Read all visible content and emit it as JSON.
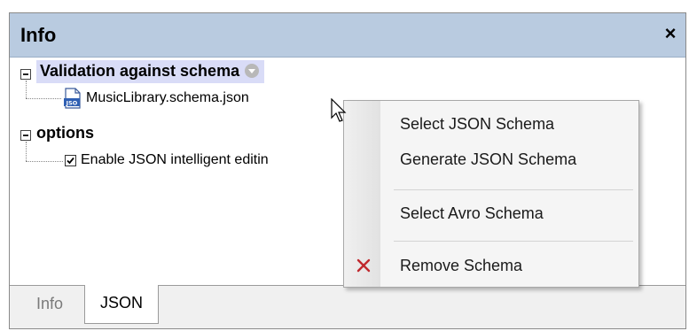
{
  "window": {
    "title": "Info",
    "close_glyph": "×"
  },
  "tree": {
    "validation": {
      "label": "Validation against schema",
      "schema_file": "MusicLibrary.schema.json"
    },
    "options": {
      "label": "options",
      "item_label": "Enable JSON intelligent editin",
      "item_checked": true
    }
  },
  "context_menu": {
    "items": [
      {
        "label": "Select JSON Schema"
      },
      {
        "label": "Generate JSON Schema"
      },
      {
        "label": "Select Avro Schema"
      },
      {
        "label": "Remove Schema",
        "icon": "red-x-icon"
      }
    ]
  },
  "tabs": [
    {
      "label": "Info",
      "active": false
    },
    {
      "label": "JSON",
      "active": true
    }
  ],
  "colors": {
    "title_bar": "#b9cbe0",
    "highlight": "#d9dcf7",
    "remove_icon": "#c0282d"
  }
}
